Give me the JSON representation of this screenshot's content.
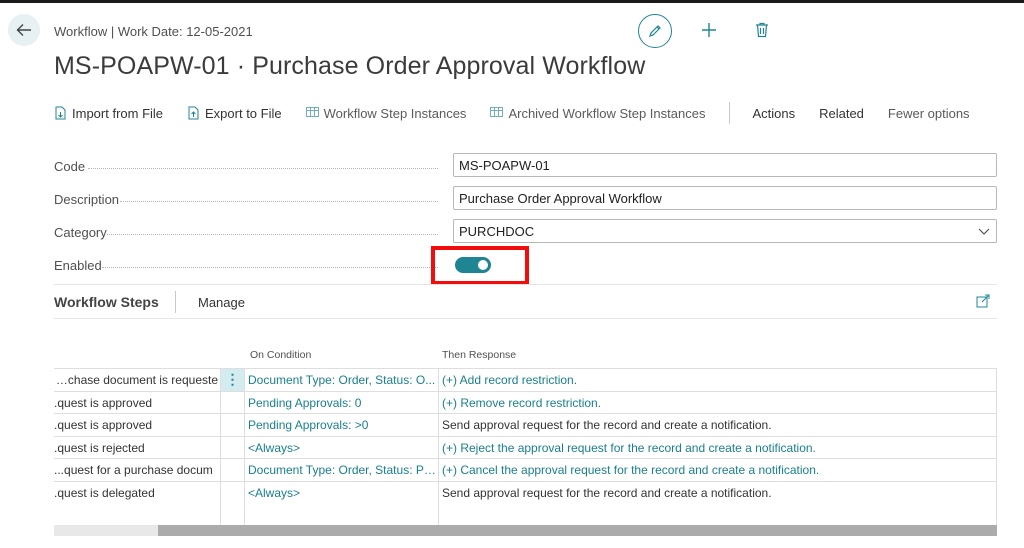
{
  "header": {
    "breadcrumb": "Workflow | Work Date: 12-05-2021",
    "title": "MS-POAPW-01 · Purchase Order Approval Workflow"
  },
  "toolbar": {
    "items": [
      {
        "label": "Import from File",
        "icon": "import-file-icon"
      },
      {
        "label": "Export to File",
        "icon": "export-file-icon"
      },
      {
        "label": "Workflow Step Instances",
        "icon": "table-icon"
      },
      {
        "label": "Archived Workflow Step Instances",
        "icon": "table-icon"
      }
    ],
    "menus": [
      "Actions",
      "Related",
      "Fewer options"
    ]
  },
  "fields": {
    "code": {
      "label": "Code",
      "value": "MS-POAPW-01"
    },
    "description": {
      "label": "Description",
      "value": "Purchase Order Approval Workflow"
    },
    "category": {
      "label": "Category",
      "value": "PURCHDOC"
    },
    "enabled": {
      "label": "Enabled",
      "value": true
    }
  },
  "steps": {
    "title": "Workflow Steps",
    "manage_label": "Manage",
    "columns": [
      "On Condition",
      "Then Response"
    ],
    "rows": [
      {
        "when": "rchase document is requeste...",
        "condition": "Document Type: Order, Status: O...",
        "response": "(+) Add record restriction.",
        "response_link": true
      },
      {
        "when": "quest is approved.",
        "condition": "Pending Approvals: 0",
        "response": "(+) Remove record restriction.",
        "response_link": true
      },
      {
        "when": "quest is approved.",
        "condition": "Pending Approvals: >0",
        "response": "Send approval request for the record and create a notification.",
        "response_link": false
      },
      {
        "when": "quest is rejected.",
        "condition": "<Always>",
        "response": "(+) Reject the approval request for the record and create a notification.",
        "response_link": true
      },
      {
        "when": "quest for a purchase docum...",
        "condition": "Document Type: Order, Status: Pe...",
        "response": "(+) Cancel the approval request for the record and create a notification.",
        "response_link": true
      },
      {
        "when": "quest is delegated.",
        "condition": "<Always>",
        "response": "Send approval request for the record and create a notification.",
        "response_link": false
      }
    ]
  },
  "colors": {
    "accent": "#1f8593",
    "highlight": "#f20c0c"
  }
}
